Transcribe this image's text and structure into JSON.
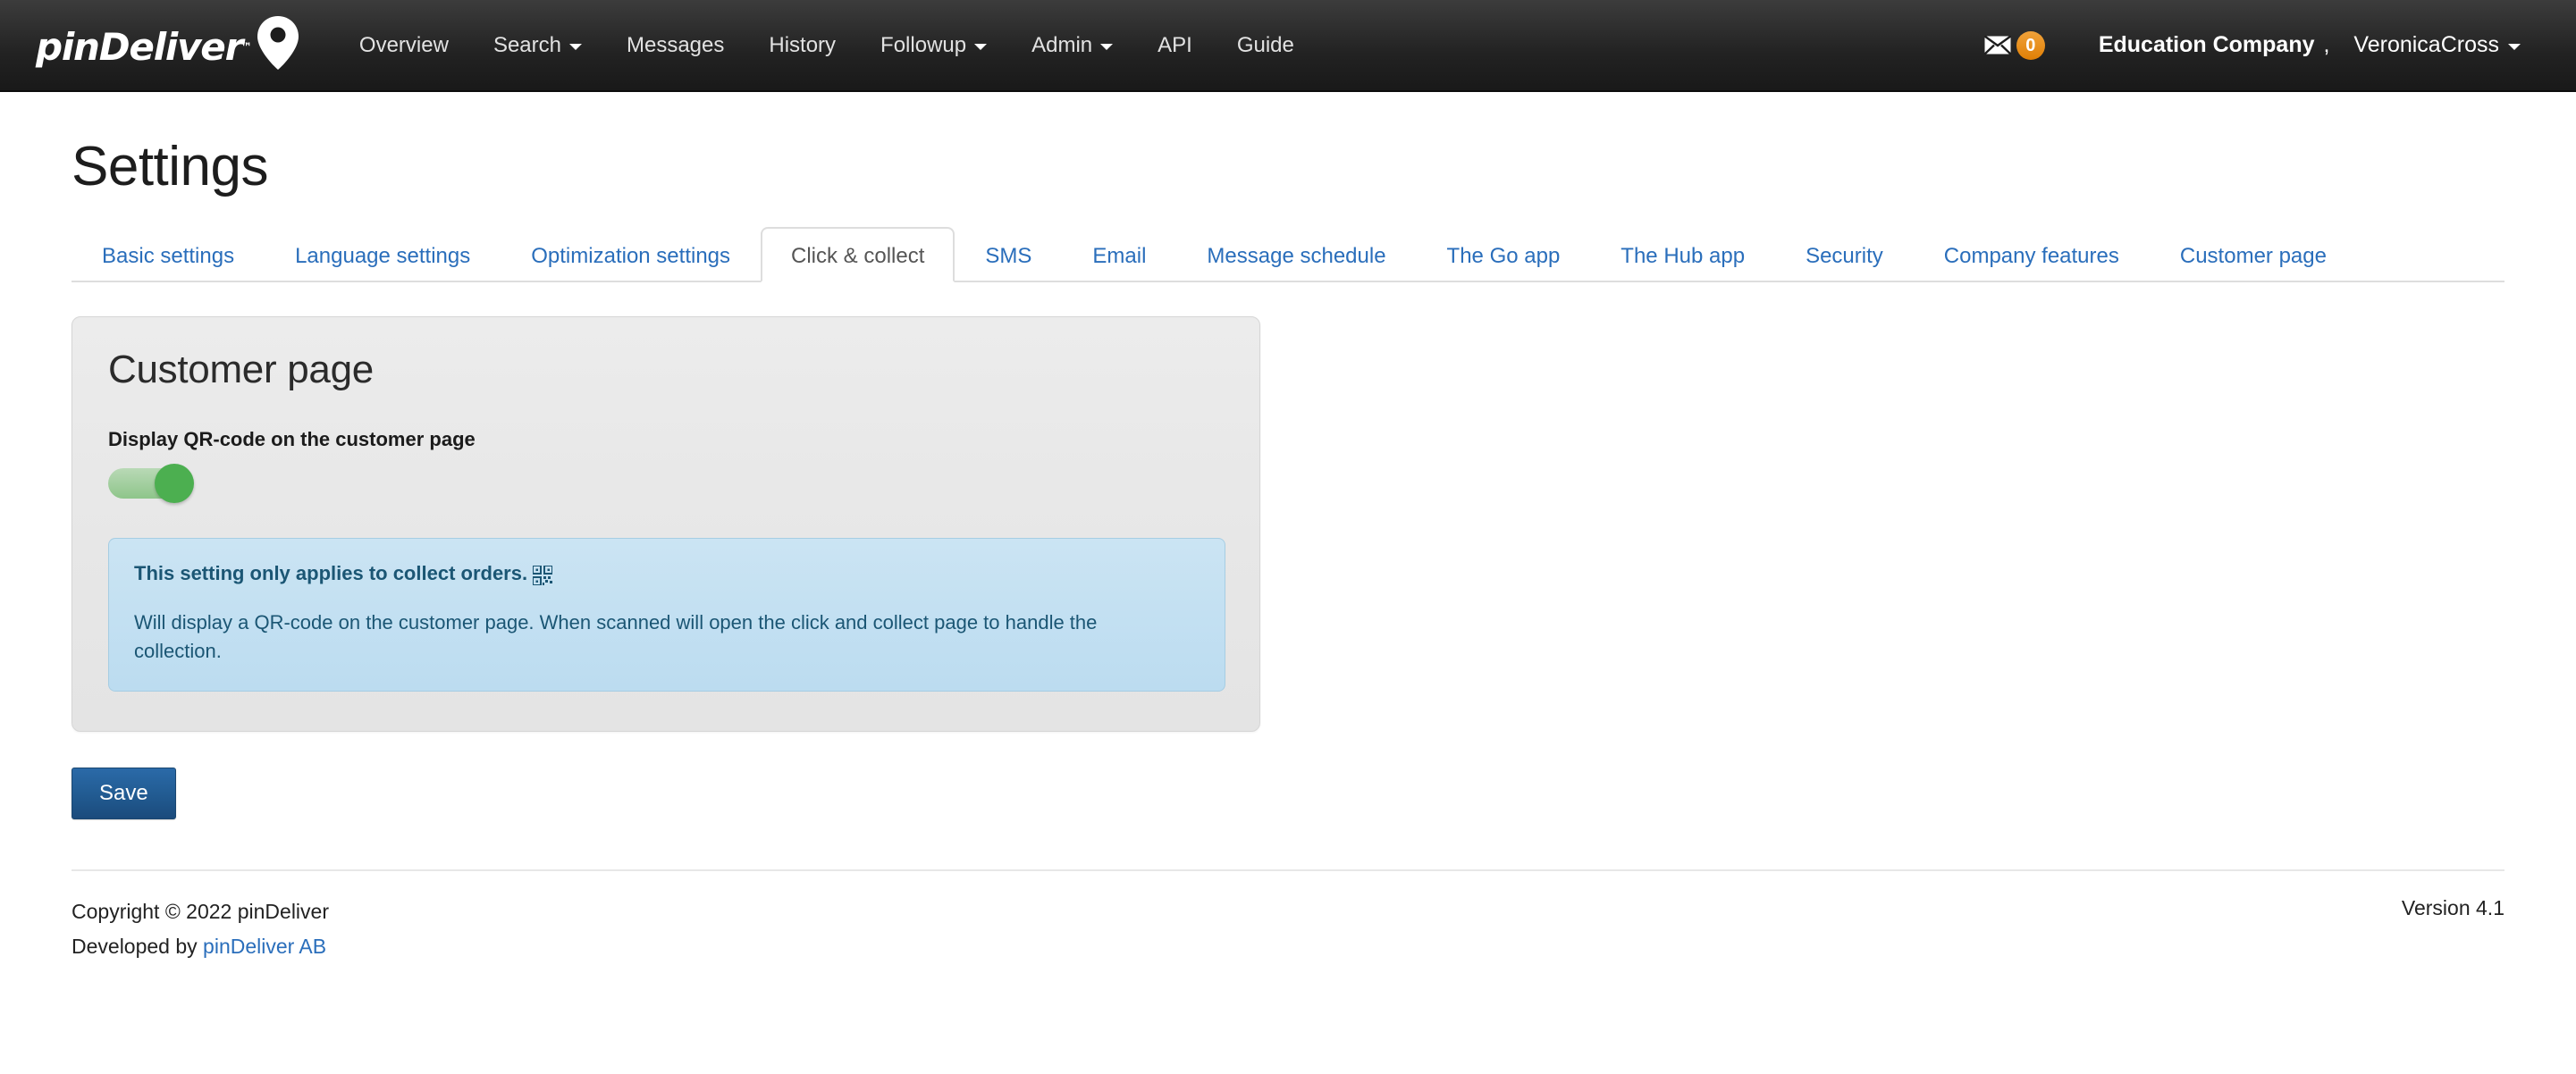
{
  "navbar": {
    "brand": {
      "text": "pinDeliver",
      "tm": "™",
      "icon": "map-pin-icon"
    },
    "links": [
      {
        "label": "Overview",
        "dropdown": false
      },
      {
        "label": "Search",
        "dropdown": true
      },
      {
        "label": "Messages",
        "dropdown": false
      },
      {
        "label": "History",
        "dropdown": false
      },
      {
        "label": "Followup",
        "dropdown": true
      },
      {
        "label": "Admin",
        "dropdown": true
      },
      {
        "label": "API",
        "dropdown": false
      },
      {
        "label": "Guide",
        "dropdown": false
      }
    ],
    "messages": {
      "icon": "envelope-icon",
      "count": "0",
      "badge_color": "#e8880c"
    },
    "user": {
      "company": "Education Company",
      "separator": ",",
      "name": "VeronicaCross"
    }
  },
  "page": {
    "title": "Settings"
  },
  "tabs": [
    {
      "label": "Basic settings",
      "active": false
    },
    {
      "label": "Language settings",
      "active": false
    },
    {
      "label": "Optimization settings",
      "active": false
    },
    {
      "label": "Click & collect",
      "active": true
    },
    {
      "label": "SMS",
      "active": false
    },
    {
      "label": "Email",
      "active": false
    },
    {
      "label": "Message schedule",
      "active": false
    },
    {
      "label": "The Go app",
      "active": false
    },
    {
      "label": "The Hub app",
      "active": false
    },
    {
      "label": "Security",
      "active": false
    },
    {
      "label": "Company features",
      "active": false
    },
    {
      "label": "Customer page",
      "active": false
    }
  ],
  "panel": {
    "title": "Customer page",
    "setting": {
      "label": "Display QR-code on the customer page",
      "toggle_state": "on",
      "toggle_on_color": "#4caf50"
    },
    "alert": {
      "heading": "This setting only applies to collect orders.",
      "heading_icon": "qr-code-icon",
      "body": "Will display a QR-code on the customer page. When scanned will open the click and collect page to handle the collection.",
      "accent_color": "#1b5674"
    }
  },
  "actions": {
    "save_label": "Save",
    "save_color": "#225c93"
  },
  "footer": {
    "copyright": "Copyright © 2022 pinDeliver",
    "developed_prefix": "Developed by ",
    "developed_link": "pinDeliver AB",
    "version": "Version 4.1"
  }
}
